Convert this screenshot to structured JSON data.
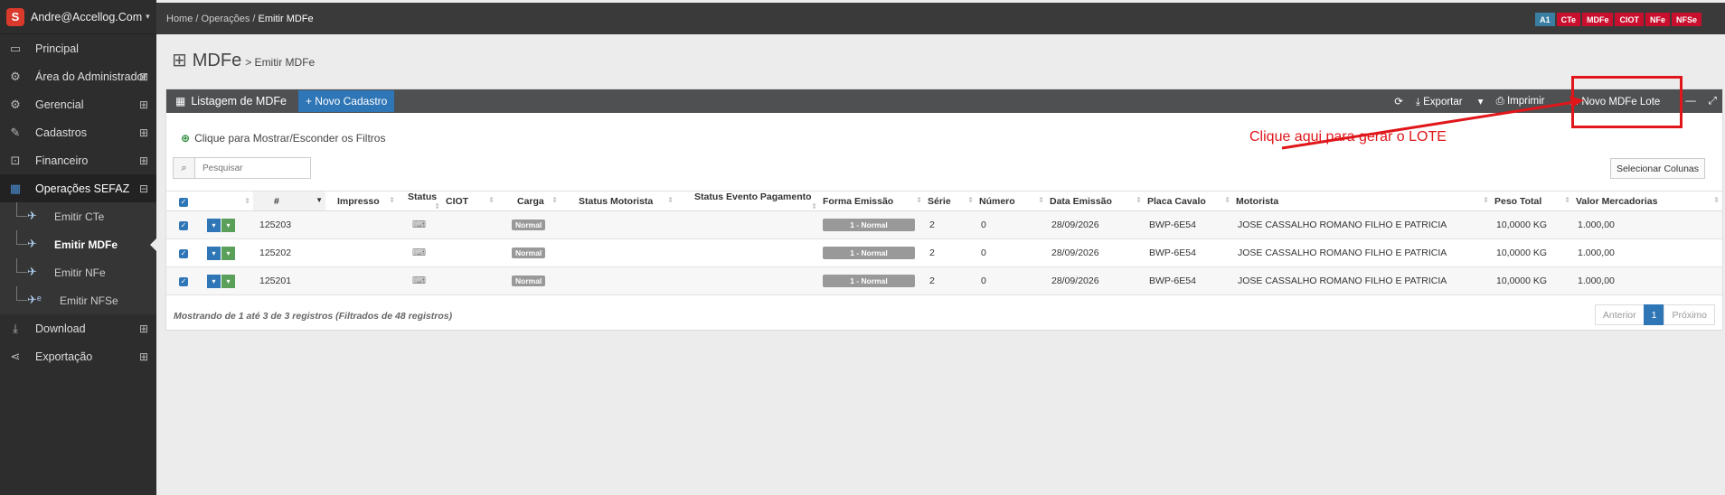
{
  "sidebar": {
    "user": "Andre@Accellog.Com",
    "items": [
      {
        "label": "Principal",
        "icon": "monitor-icon"
      },
      {
        "label": "Área do Administrador",
        "icon": "gears-icon"
      },
      {
        "label": "Gerencial",
        "icon": "gears-icon"
      },
      {
        "label": "Cadastros",
        "icon": "edit-icon"
      },
      {
        "label": "Financeiro",
        "icon": "money-icon"
      },
      {
        "label": "Operações SEFAZ",
        "icon": "windows-icon"
      },
      {
        "label": "Download",
        "icon": "download-icon"
      },
      {
        "label": "Exportação",
        "icon": "share-icon"
      }
    ],
    "sub": [
      "Emitir CTe",
      "Emitir MDFe",
      "Emitir NFe",
      "Emitir NFSe"
    ]
  },
  "topbar": {
    "bc_home": "Home",
    "bc_sep": "/",
    "bc_ops": "Operações",
    "bc_current": "Emitir MDFe",
    "badges": [
      "A1",
      "CTe",
      "MDFe",
      "CIOT",
      "NFe",
      "NFSe"
    ]
  },
  "page": {
    "title": "MDFe",
    "subtitle": "> Emitir MDFe"
  },
  "panel": {
    "title": "Listagem de MDFe",
    "new_button": "+ Novo Cadastro",
    "export": "Exportar",
    "print": "Imprimir",
    "new_lote": "Novo MDFe Lote",
    "filters": "Clique para Mostrar/Esconder os Filtros",
    "search_placeholder": "Pesquisar",
    "select_columns": "Selecionar Colunas",
    "annotation": "Clique aqui para gerar o LOTE"
  },
  "table": {
    "headers": [
      "#",
      "Impresso",
      "Status",
      "CIOT",
      "Carga",
      "Status Motorista",
      "Status Evento Pagamento",
      "Forma Emissão",
      "Série",
      "Número",
      "Data Emissão",
      "Placa Cavalo",
      "Motorista",
      "Peso Total",
      "Valor Mercadorias"
    ],
    "rows": [
      {
        "id": "125203",
        "carga": "Normal",
        "forma": "1 - Normal",
        "serie": "2",
        "numero": "0",
        "data": "28/09/2026",
        "placa": "BWP-6E54",
        "motorista": "JOSE CASSALHO ROMANO FILHO E PATRICIA",
        "peso": "10,0000 KG",
        "valor": "1.000,00"
      },
      {
        "id": "125202",
        "carga": "Normal",
        "forma": "1 - Normal",
        "serie": "2",
        "numero": "0",
        "data": "28/09/2026",
        "placa": "BWP-6E54",
        "motorista": "JOSE CASSALHO ROMANO FILHO E PATRICIA",
        "peso": "10,0000 KG",
        "valor": "1.000,00"
      },
      {
        "id": "125201",
        "carga": "Normal",
        "forma": "1 - Normal",
        "serie": "2",
        "numero": "0",
        "data": "28/09/2026",
        "placa": "BWP-6E54",
        "motorista": "JOSE CASSALHO ROMANO FILHO E PATRICIA",
        "peso": "10,0000 KG",
        "valor": "1.000,00"
      }
    ],
    "info": "Mostrando de 1 até 3 de 3 registros (Filtrados de 48 registros)",
    "prev": "Anterior",
    "page": "1",
    "next": "Próximo"
  },
  "colors": {
    "accent": "#2f76b6",
    "annotation": "#e0161a",
    "badge_a1": "#3b7ea3",
    "badge_red": "#c8102e"
  }
}
